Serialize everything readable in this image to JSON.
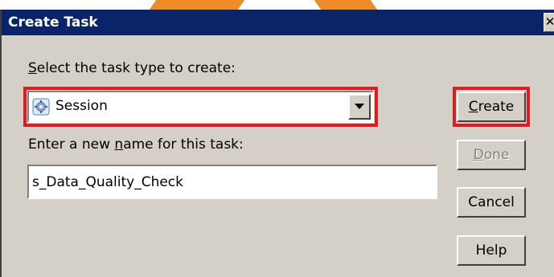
{
  "window": {
    "title": "Create Task"
  },
  "task_type": {
    "label_pre": "",
    "label_mnemonic": "S",
    "label_post": "elect the task type to create:",
    "selected_value": "Session",
    "selected_icon": "session-gear-icon"
  },
  "task_name": {
    "label_pre": "Enter a new ",
    "label_mnemonic": "n",
    "label_post": "ame for this task:",
    "value": "s_Data_Quality_Check"
  },
  "buttons": {
    "create": {
      "mnemonic": "C",
      "rest": "reate"
    },
    "done": {
      "mnemonic": "D",
      "rest": "one"
    },
    "cancel": "Cancel",
    "help": "Help"
  },
  "colors": {
    "titlebar": "#0a246a",
    "highlight_box": "#e21b23",
    "window_face": "#d4d0c8"
  }
}
